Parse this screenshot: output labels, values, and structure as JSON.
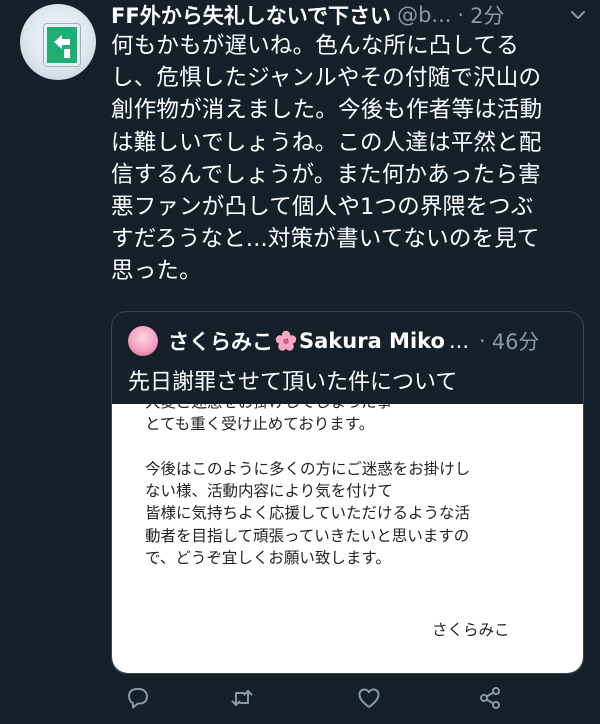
{
  "tweet": {
    "display_name": "FF外から失礼しないで下さい",
    "handle": "@b...",
    "separator": "·",
    "time": "2分",
    "text": "何もかもが遅いね。色んな所に凸してる\nし、危惧したジャンルやその付随で沢山の\n創作物が消えました。今後も作者等は活動\nは難しいでしょうね。この人達は平然と配\n信するんでしょうが。また何かあったら害\n悪ファンが凸して個人や1つの界隈をつぶ\nすだろうなと...対策が書いてないのを見て\n思った。"
  },
  "quote": {
    "display_name": "さくらみこ",
    "name_suffix": "Sakura Miko",
    "ellipsis": "...",
    "separator": "·",
    "time": "46分",
    "text": "先日謝罪させて頂いた件について",
    "image_text": "大変ご迷惑をお掛けしてしまった事\nとても重く受け止めております。\n\n今後はこのように多くの方にご迷惑をお掛けし\nない様、活動内容により気を付けて\n皆様に気持ちよく応援していただけるような活\n動者を目指して頑張っていきたいと思いますの\nで、どうぞ宜しくお願い致します。",
    "image_signature": "さくらみこ"
  },
  "icons": {
    "menu": "chevron-down-icon",
    "reply": "reply-icon",
    "retweet": "retweet-icon",
    "like": "heart-icon",
    "share": "share-icon",
    "flower": "cherry-blossom-icon"
  },
  "colors": {
    "background": "#15202b",
    "secondary_text": "#8b98a5",
    "border": "#38444d"
  }
}
